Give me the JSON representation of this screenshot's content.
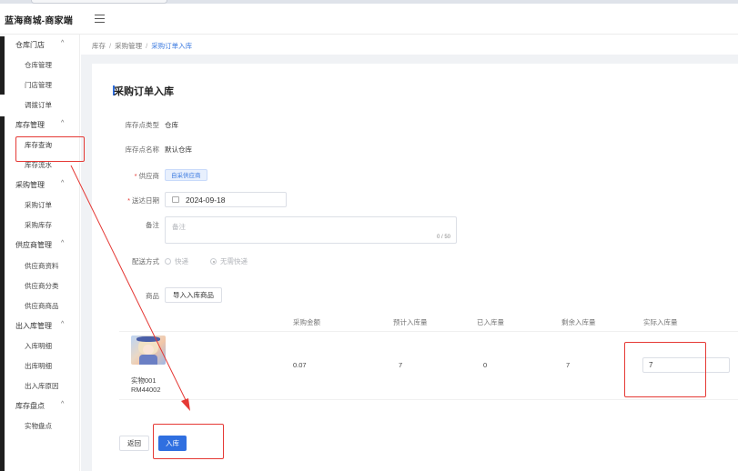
{
  "app": {
    "brand": "蓝海商城-商家端"
  },
  "sidebar": {
    "groups": [
      {
        "label": "仓库门店",
        "items": [
          "仓库管理",
          "门店管理",
          "调拨订单"
        ]
      },
      {
        "label": "库存管理",
        "items": [
          "库存查询",
          "库存流水"
        ]
      },
      {
        "label": "采购管理",
        "items": [
          "采购订单",
          "采购库存"
        ]
      },
      {
        "label": "供应商管理",
        "items": [
          "供应商资料",
          "供应商分类",
          "供应商商品"
        ]
      },
      {
        "label": "出入库管理",
        "items": [
          "入库明细",
          "出库明细",
          "出入库原因"
        ]
      },
      {
        "label": "库存盘点",
        "items": [
          "实物盘点"
        ]
      }
    ]
  },
  "breadcrumb": [
    "库存",
    "采购管理",
    "采购订单入库"
  ],
  "page": {
    "title": "采购订单入库"
  },
  "form": {
    "stock_type_label": "库存点类型",
    "stock_type_value": "仓库",
    "stock_name_label": "库存点名称",
    "stock_name_value": "默认仓库",
    "supplier_label": "供应商",
    "supplier_value": "自采供应商",
    "date_label": "送达日期",
    "date_value": "2024-09-18",
    "remark_label": "备注",
    "remark_placeholder": "备注",
    "remark_count": "0 / 50",
    "delivery_label": "配送方式",
    "delivery_options": [
      "快递",
      "无需快递"
    ],
    "goods_label": "商品",
    "import_button": "导入入库商品"
  },
  "table": {
    "columns": [
      "采购金额",
      "预计入库量",
      "已入库量",
      "剩余入库量",
      "实际入库量"
    ],
    "rows": [
      {
        "name": "实物001",
        "code": "RM44002",
        "amount": "0.07",
        "expected": "7",
        "received": "0",
        "remaining": "7",
        "actual": "7"
      }
    ]
  },
  "footer": {
    "back_label": "返回",
    "submit_label": "入库"
  },
  "colors": {
    "primary": "#2f6fe0",
    "annotation_red": "#e53935"
  }
}
